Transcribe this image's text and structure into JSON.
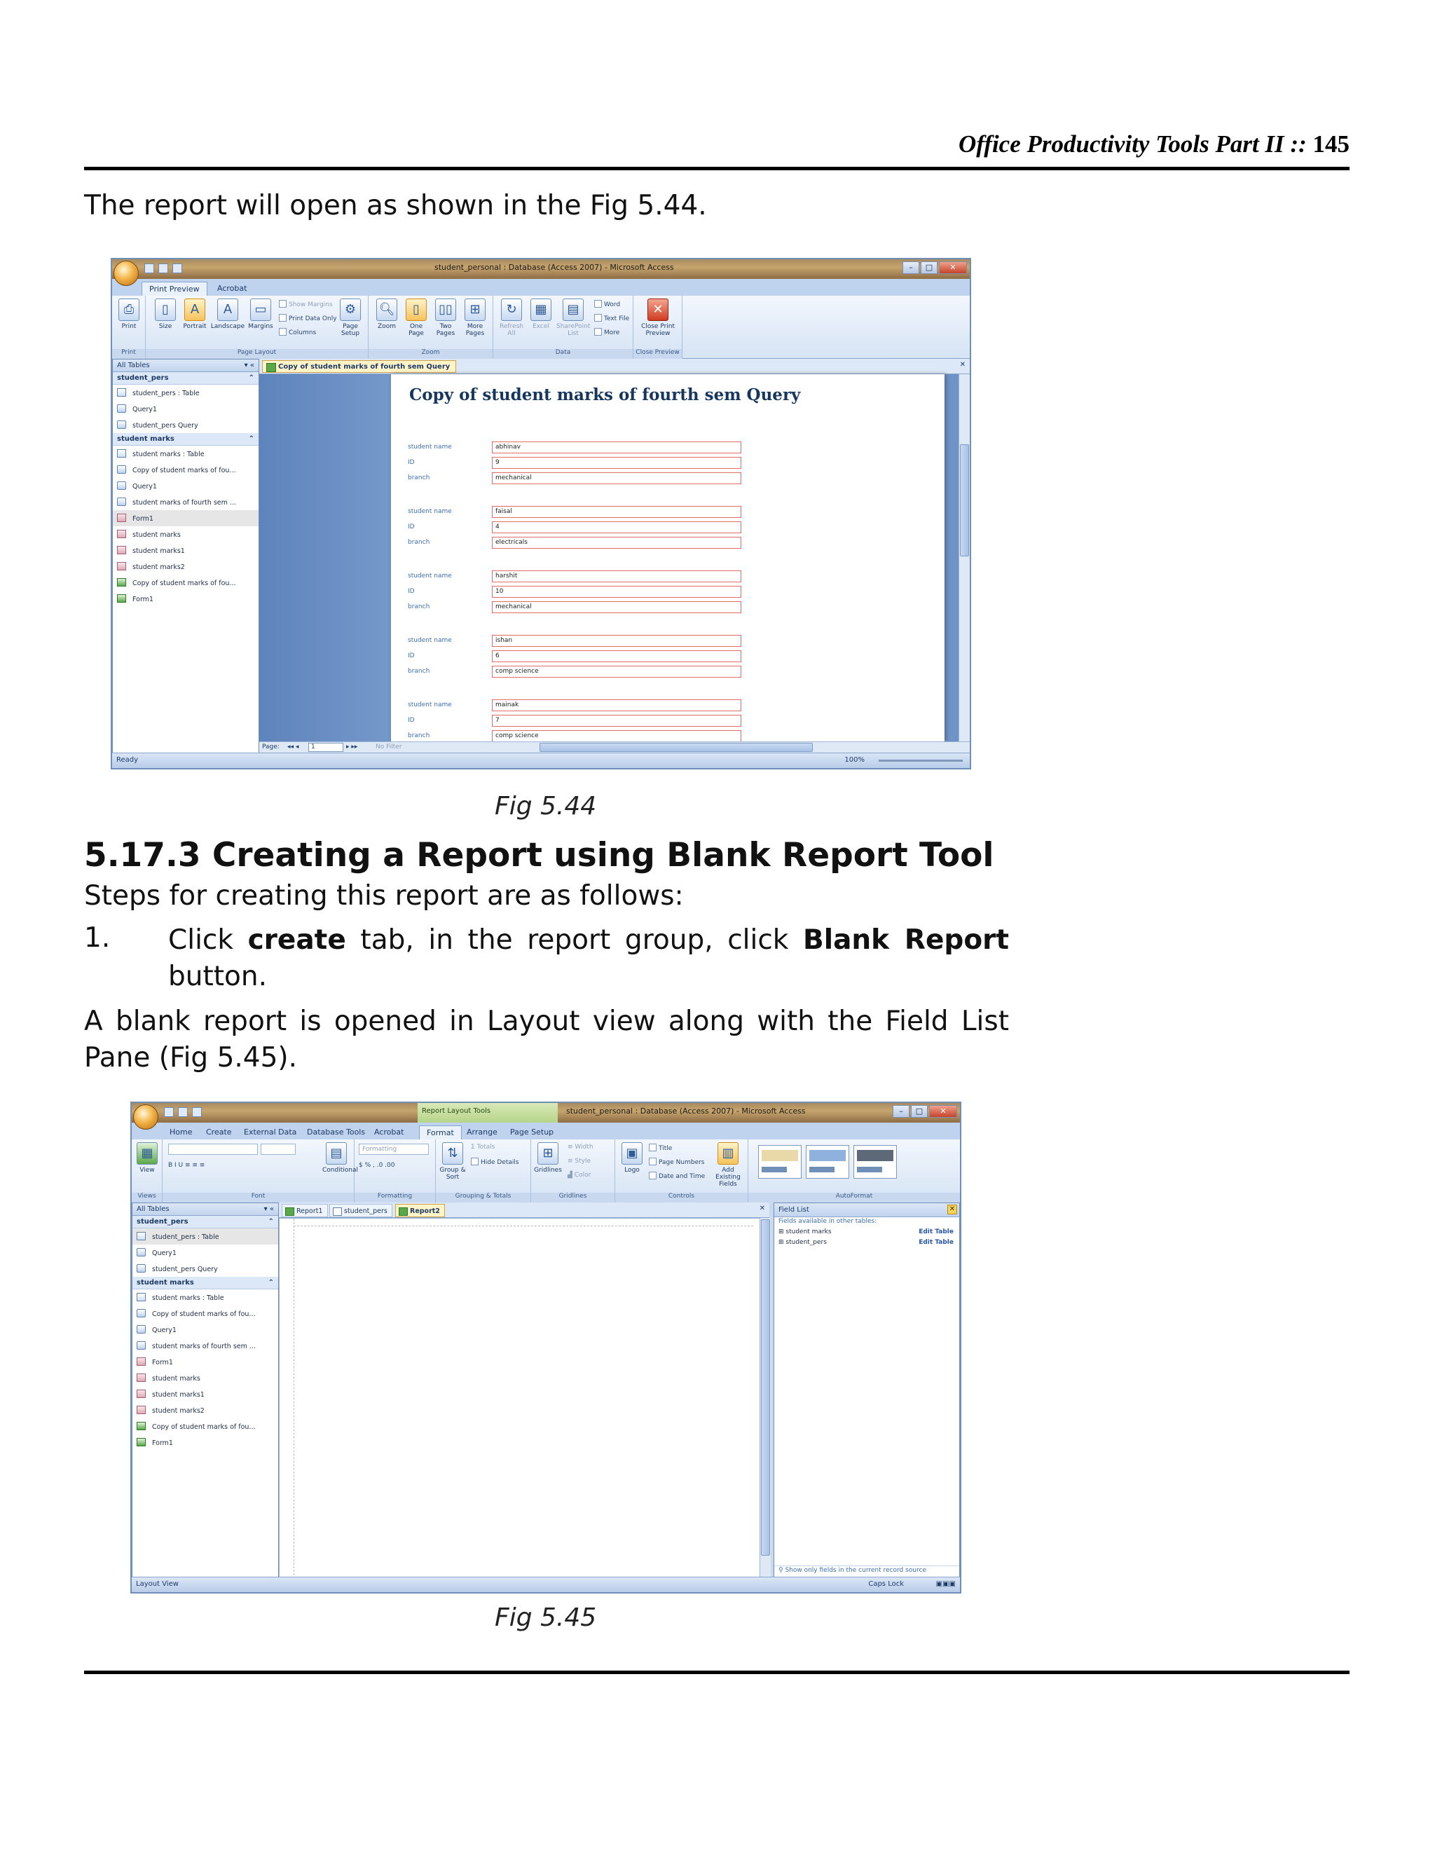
{
  "header": {
    "title": "Office Productivity Tools Part II",
    "sep": "::",
    "page": "145"
  },
  "intro": "The report will open as shown in the Fig 5.44.",
  "fig44": {
    "caption": "Fig 5.44",
    "title_bar": "student_personal : Database (Access 2007) - Microsoft Access",
    "tabs": [
      "Print Preview",
      "Acrobat"
    ],
    "ribbon": {
      "print": "Print",
      "size": "Size",
      "portrait": "Portrait",
      "landscape": "Landscape",
      "margins": "Margins",
      "show_margins": "Show Margins",
      "print_data_only": "Print Data Only",
      "columns": "Columns",
      "page_setup": "Page Setup",
      "zoom": "Zoom",
      "one_page": "One Page",
      "two_pages": "Two Pages",
      "more_pages": "More Pages",
      "refresh_all": "Refresh All",
      "excel": "Excel",
      "sharepoint_list": "SharePoint List",
      "word": "Word",
      "text_file": "Text File",
      "more": "More",
      "close_print_preview": "Close Print Preview",
      "groups": [
        "Print",
        "Page Layout",
        "Zoom",
        "Data",
        "Close Preview"
      ]
    },
    "nav": {
      "header": "All Tables",
      "groups": [
        {
          "name": "student_pers",
          "items": [
            {
              "label": "student_pers : Table",
              "kind": "t"
            },
            {
              "label": "Query1",
              "kind": "q"
            },
            {
              "label": "student_pers Query",
              "kind": "q"
            }
          ]
        },
        {
          "name": "student marks",
          "items": [
            {
              "label": "student marks : Table",
              "kind": "t"
            },
            {
              "label": "Copy of student marks of fou...",
              "kind": "q"
            },
            {
              "label": "Query1",
              "kind": "q"
            },
            {
              "label": "student marks of fourth sem ...",
              "kind": "q"
            },
            {
              "label": "Form1",
              "kind": "f",
              "selected": true
            },
            {
              "label": "student marks",
              "kind": "f"
            },
            {
              "label": "student marks1",
              "kind": "f"
            },
            {
              "label": "student marks2",
              "kind": "f"
            },
            {
              "label": "Copy of student marks of fou...",
              "kind": "r"
            },
            {
              "label": "Form1",
              "kind": "r"
            }
          ]
        }
      ]
    },
    "doc_tab": "Copy of student marks of fourth sem Query",
    "report_title": "Copy of student marks of fourth sem Query",
    "field_labels": [
      "student name",
      "ID",
      "branch"
    ],
    "records": [
      {
        "name": "abhinav",
        "id": "9",
        "branch": "mechanical"
      },
      {
        "name": "faisal",
        "id": "4",
        "branch": "electricals"
      },
      {
        "name": "harshit",
        "id": "10",
        "branch": "mechanical"
      },
      {
        "name": "ishan",
        "id": "6",
        "branch": "comp science"
      },
      {
        "name": "mainak",
        "id": "7",
        "branch": "comp science"
      }
    ],
    "page_label": "Page:",
    "page_num": "1",
    "no_filter": "No Filter",
    "status": "Ready",
    "zoom": "100%"
  },
  "section_heading": "5.17.3 Creating a Report using Blank Report Tool",
  "steps_intro": "Steps for creating this report are as follows:",
  "step1": {
    "num": "1.",
    "pre": "Click ",
    "bold1": "create",
    "mid": " tab, in the report group, click ",
    "bold2": "Blank Report",
    "post": " button."
  },
  "para2": "A blank report is opened in Layout view along with the Field List Pane (Fig 5.45).",
  "fig45": {
    "caption": "Fig 5.45",
    "context_tab": "Report Layout Tools",
    "title_bar": "student_personal : Database (Access 2007) - Microsoft Access",
    "tabs": [
      "Home",
      "Create",
      "External Data",
      "Database Tools",
      "Acrobat",
      "Format",
      "Arrange",
      "Page Setup"
    ],
    "ribbon": {
      "view": "View",
      "formatting": "Formatting",
      "conditional": "Conditional",
      "totals": "Totals",
      "hide_details": "Hide Details",
      "group_sort": "Group & Sort",
      "gridlines": "Gridlines",
      "width": "Width",
      "style": "Style",
      "color": "Color",
      "logo": "Logo",
      "title": "Title",
      "page_numbers": "Page Numbers",
      "date_time": "Date and Time",
      "add_existing_fields": "Add Existing Fields",
      "groups": [
        "Views",
        "Font",
        "Formatting",
        "Grouping & Totals",
        "Gridlines",
        "Controls",
        "AutoFormat"
      ]
    },
    "doc_tabs": [
      "Report1",
      "student_pers",
      "Report2"
    ],
    "field_list": {
      "header": "Field List",
      "sub": "Fields available in other tables:",
      "tables": [
        {
          "name": "student marks",
          "action": "Edit Table"
        },
        {
          "name": "student_pers",
          "action": "Edit Table"
        }
      ],
      "footer": "Show only fields in the current record source"
    },
    "status_left": "Layout View",
    "status_right": "Caps Lock"
  }
}
